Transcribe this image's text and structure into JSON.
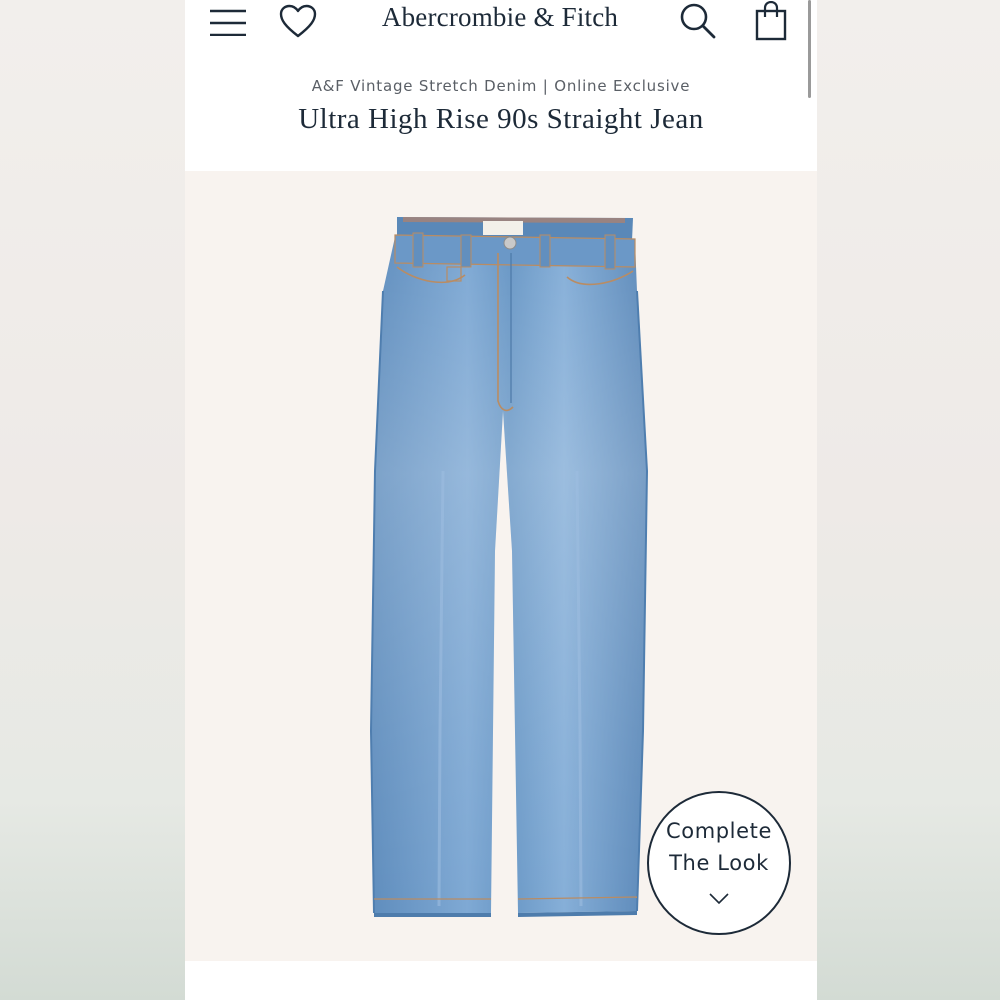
{
  "header": {
    "brand": "Abercrombie & Fitch",
    "icons": [
      "menu-icon",
      "heart-icon",
      "search-icon",
      "bag-icon"
    ]
  },
  "product": {
    "collection": "A&F Vintage Stretch Denim | Online Exclusive",
    "name": "Ultra High Rise 90s Straight Jean",
    "image_subject": "light wash straight leg jeans"
  },
  "complete_look": {
    "line1": "Complete",
    "line2": "The Look"
  },
  "colors": {
    "brand_navy": "#1d2a38",
    "denim": "#6f9cc9",
    "image_background": "#f8f3ef"
  }
}
